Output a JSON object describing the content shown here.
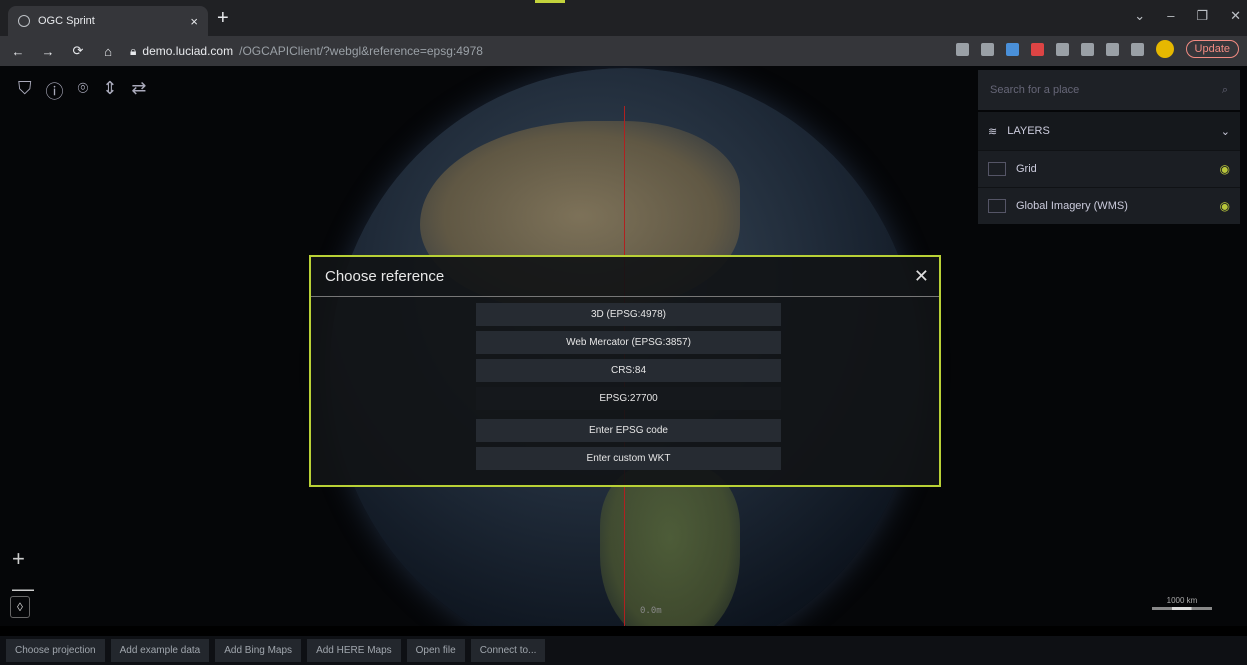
{
  "browser": {
    "tab_title": "OGC Sprint",
    "tab_close": "×",
    "new_tab": "+",
    "url_host": "demo.luciad.com",
    "url_path": "/OGCAPIClient/?webgl&reference=epsg:4978",
    "update_label": "Update",
    "window_controls": [
      "⌄",
      "–",
      "❐",
      "✕"
    ],
    "nav": {
      "back": "←",
      "forward": "→",
      "reload": "⟳",
      "home": "⌂"
    }
  },
  "map": {
    "tool_icons": [
      "⛉",
      "ⓘ",
      "⌾",
      "⇕",
      "⇄"
    ],
    "zoom_in": "+",
    "zoom_out": "—",
    "compass": "◊",
    "scale_label": "1000 km",
    "altitude_readout": "0.0m"
  },
  "panel": {
    "search_placeholder": "Search for a place",
    "search_icon": "⌕",
    "layers_title": "LAYERS",
    "layers_icon": "≋",
    "chevron": "⌄",
    "layers": [
      {
        "label": "Grid",
        "icon": "grid-icon",
        "visible": true
      },
      {
        "label": "Global Imagery (WMS)",
        "icon": "image-icon",
        "visible": true
      }
    ],
    "eye_symbol": "◉",
    "accent_color": "#b8c53a"
  },
  "dialog": {
    "title": "Choose reference",
    "close": "✕",
    "options": [
      "3D (EPSG:4978)",
      "Web Mercator (EPSG:3857)",
      "CRS:84",
      "EPSG:27700",
      "Enter EPSG code",
      "Enter custom WKT"
    ],
    "border_color": "#b9d136"
  },
  "bottombar": {
    "buttons": [
      "Choose projection",
      "Add example data",
      "Add Bing Maps",
      "Add HERE Maps",
      "Open file",
      "Connect to..."
    ]
  }
}
